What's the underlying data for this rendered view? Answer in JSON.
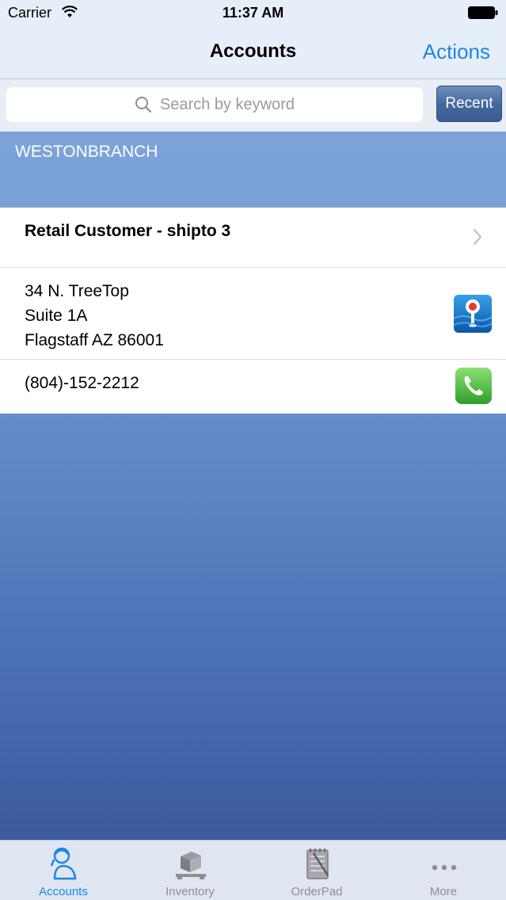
{
  "status_bar": {
    "carrier": "Carrier",
    "time": "11:37 AM"
  },
  "nav": {
    "title": "Accounts",
    "actions_label": "Actions"
  },
  "search": {
    "placeholder": "Search by keyword",
    "recent_label": "Recent"
  },
  "section": {
    "header": "WESTONBRANCH"
  },
  "account": {
    "name": "Retail Customer - shipto 3",
    "address_lines": [
      "34 N. TreeTop",
      "Suite 1A",
      "Flagstaff AZ 86001"
    ],
    "phone": "(804)-152-2212"
  },
  "tabs": [
    {
      "label": "Accounts",
      "icon": "person-headset-icon",
      "active": true
    },
    {
      "label": "Inventory",
      "icon": "boxes-pallet-icon",
      "active": false
    },
    {
      "label": "OrderPad",
      "icon": "notepad-icon",
      "active": false
    },
    {
      "label": "More",
      "icon": "more-dots-icon",
      "active": false
    }
  ],
  "colors": {
    "accent": "#1b86e6",
    "recent_button": "#45699e",
    "background_top": "#7fa7dc",
    "background_bottom": "#3b5a9e"
  }
}
